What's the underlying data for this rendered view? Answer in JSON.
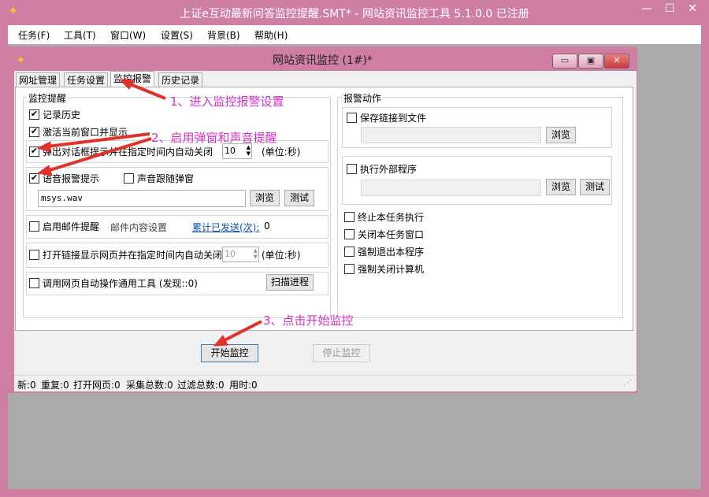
{
  "window": {
    "title": "上证e互动最新问答监控提醒.SMT* - 网站资讯监控工具 5.1.0.0 已注册",
    "controls": [
      "—",
      "☐",
      "✕"
    ]
  },
  "menu": [
    "任务(F)",
    "工具(T)",
    "窗口(W)",
    "设置(S)",
    "背景(B)",
    "帮助(H)"
  ],
  "child": {
    "title": "网站资讯监控 (1#)*",
    "controls": [
      "▭",
      "▣",
      "✕"
    ]
  },
  "tabs": [
    "网址管理",
    "任务设置",
    "监控报警",
    "历史记录"
  ],
  "monitor": {
    "group_label": "监控提醒",
    "record_history": "记录历史",
    "activate_window": "激活当前窗口并显示",
    "popup_dialog": "弹出对话框提示并在指定时间内自动关闭",
    "popup_seconds": "10",
    "unit": "(单位:秒)",
    "sound_alert": "语音报警提示",
    "sound_follow": "声音跟随弹窗",
    "sound_file": "msys.wav",
    "browse": "浏览",
    "test": "测试",
    "email_alert": "启用邮件提醒",
    "email_settings": "邮件内容设置",
    "sent_count_label": "累计已发送(次):",
    "sent_count": "0",
    "open_link": "打开链接显示网页并在指定时间内自动关闭",
    "open_link_seconds": "10",
    "unit2": "(单位:秒)",
    "auto_tool": "调用网页自动操作通用工具 (发现::0)",
    "scan_process": "扫描进程"
  },
  "alarm": {
    "group_label": "报警动作",
    "save_link": "保存链接到文件",
    "browse": "浏览",
    "exec_program": "执行外部程序",
    "browse2": "浏览",
    "test": "测试",
    "stop_task": "终止本任务执行",
    "close_window": "关闭本任务窗口",
    "force_exit": "强制退出本程序",
    "force_shutdown": "强制关闭计算机"
  },
  "buttons": {
    "start": "开始监控",
    "stop": "停止监控"
  },
  "status": {
    "new": "新:0",
    "dup": "重复:0",
    "opened": "打开网页:0",
    "collected": "采集总数:0",
    "filtered": "过滤总数:0",
    "elapsed": "用时:0"
  },
  "annotations": {
    "step1": "1、进入监控报警设置",
    "step2": "2、启用弹窗和声音提醒",
    "step3": "3、点击开始监控"
  }
}
